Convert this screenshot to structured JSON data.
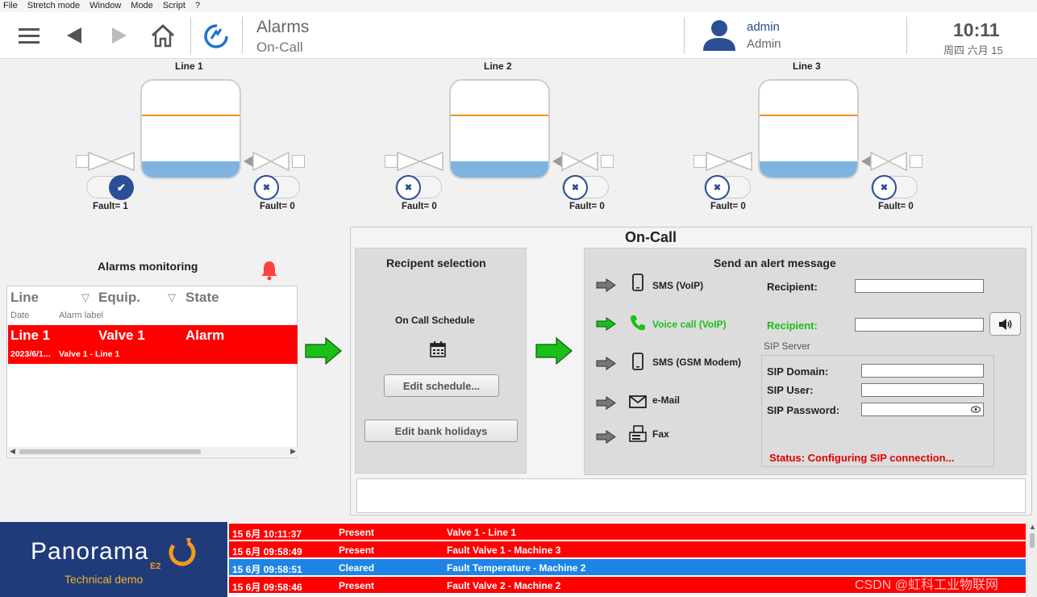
{
  "menu": [
    "File",
    "Stretch mode",
    "Window",
    "Mode",
    "Script",
    "?"
  ],
  "header": {
    "title": "Alarms",
    "subtitle": "On-Call",
    "user_name": "admin",
    "user_role": "Admin",
    "time": "10:11",
    "date": "周四 六月 15"
  },
  "lines": [
    {
      "label": "Line 1",
      "left_fault": "Fault= 1",
      "right_fault": "Fault= 0",
      "left_state": "on",
      "right_state": "off"
    },
    {
      "label": "Line 2",
      "left_fault": "Fault= 0",
      "right_fault": "Fault= 0",
      "left_state": "off",
      "right_state": "off"
    },
    {
      "label": "Line 3",
      "left_fault": "Fault= 0",
      "right_fault": "Fault= 0",
      "left_state": "off",
      "right_state": "off"
    }
  ],
  "alarms_monitoring": {
    "title": "Alarms monitoring",
    "columns": [
      "Line",
      "Equip.",
      "State"
    ],
    "subcolumns": [
      "Date",
      "Alarm label"
    ],
    "row": {
      "line": "Line 1",
      "equip": "Valve 1",
      "state": "Alarm",
      "date": "2023/6/1...",
      "label": "Valve 1 - Line 1"
    }
  },
  "oncall": {
    "title": "On-Call",
    "recipient_title": "Recipent selection",
    "schedule_label": "On Call Schedule",
    "edit_schedule": "Edit schedule...",
    "edit_holidays": "Edit bank holidays",
    "send_title": "Send an alert message",
    "channels": [
      {
        "label": "SMS (VoIP)",
        "icon": "phone-icon",
        "active": false
      },
      {
        "label": "Voice call (VoIP)",
        "icon": "call-icon",
        "active": true
      },
      {
        "label": "SMS (GSM Modem)",
        "icon": "phone-icon",
        "active": false
      },
      {
        "label": "e-Mail",
        "icon": "mail-icon",
        "active": false
      },
      {
        "label": "Fax",
        "icon": "fax-icon",
        "active": false
      }
    ],
    "recipient_label": "Recipient:",
    "sip_server_label": "SIP Server",
    "sip_domain_label": "SIP Domain:",
    "sip_user_label": "SIP User:",
    "sip_password_label": "SIP Password:",
    "status": "Status: Configuring SIP connection..."
  },
  "brand": {
    "name": "Panorama",
    "edition": "E2",
    "subtitle": "Technical demo"
  },
  "events": [
    {
      "time": "15 6月 10:11:37",
      "status": "Present",
      "label": "Valve 1 - Line 1",
      "color": "#ff0000"
    },
    {
      "time": "15 6月 09:58:49",
      "status": "Present",
      "label": "Fault Valve 1 - Machine 3",
      "color": "#ff0000"
    },
    {
      "time": "15 6月 09:58:51",
      "status": "Cleared",
      "label": "Fault Temperature - Machine 2",
      "color": "#1e84e6"
    },
    {
      "time": "15 6月 09:58:46",
      "status": "Present",
      "label": "Fault Valve 2 - Machine 2",
      "color": "#ff0000"
    }
  ],
  "watermark": "CSDN @虹科工业物联网",
  "colors": {
    "accent": "#2b4f95",
    "alarm": "#ff0000",
    "cleared": "#1e84e6",
    "green": "#19c019",
    "brand_bg": "#203b7a"
  }
}
